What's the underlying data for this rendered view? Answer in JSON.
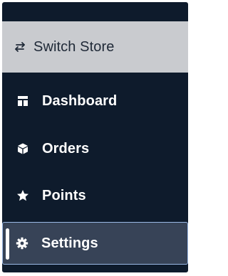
{
  "switch_store": {
    "label": "Switch Store",
    "icon": "arrows-left-right-icon"
  },
  "nav": {
    "items": [
      {
        "label": "Dashboard",
        "icon": "dashboard-icon",
        "active": false
      },
      {
        "label": "Orders",
        "icon": "cube-icon",
        "active": false
      },
      {
        "label": "Points",
        "icon": "star-icon",
        "active": false
      },
      {
        "label": "Settings",
        "icon": "gear-icon",
        "active": true
      }
    ]
  },
  "colors": {
    "sidebar_background": "#0e1b2c",
    "switch_store_background": "#c9cbcf",
    "active_background": "#374357",
    "active_border": "#9bb9e6",
    "text_light": "#ffffff",
    "text_dark": "#1f2937"
  }
}
